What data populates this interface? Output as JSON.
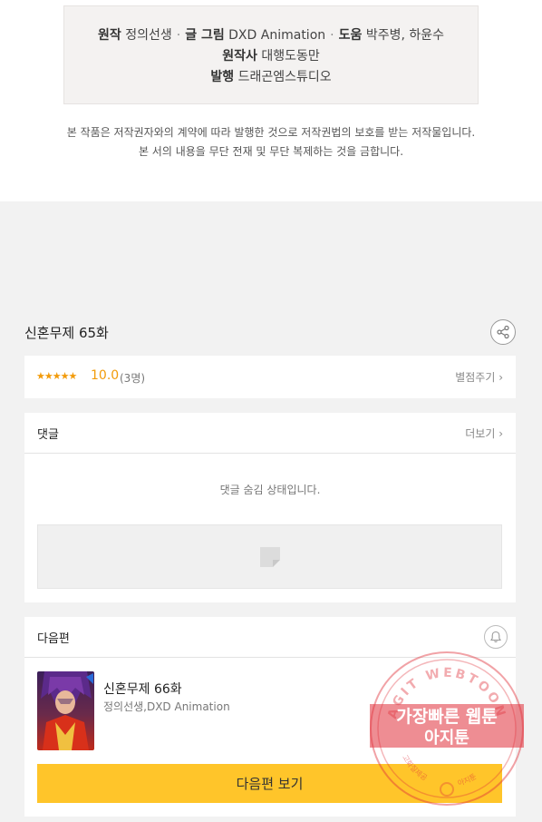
{
  "credits": {
    "line1": [
      {
        "label": "원작",
        "value": "정의선생"
      },
      {
        "label": "글 그림",
        "value": "DXD Animation"
      },
      {
        "label": "도움",
        "value": "박주병, 하윤수"
      }
    ],
    "line2": {
      "label": "원작사",
      "value": "대행도동만"
    },
    "line3": {
      "label": "발행",
      "value": "드래곤엠스튜디오"
    },
    "separator": "·"
  },
  "notice": {
    "line1": "본 작품은 저작권자와의 계약에 따라 발행한 것으로 저작권법의 보호를 받는 저작물입니다.",
    "line2": "본 서의 내용을 무단 전재 및 무단 복제하는 것을 금합니다."
  },
  "episode": {
    "title": "신혼무제 65화",
    "share_icon": "share-icon"
  },
  "rating": {
    "stars": "★★★★★",
    "score": "10.0",
    "count": "(3명)",
    "rate_link": "별점주기 ›"
  },
  "comments": {
    "title": "댓글",
    "more_link": "더보기 ›",
    "hidden_message": "댓글 숨김 상태입니다."
  },
  "next_episode": {
    "section_title": "다음편",
    "bell_icon": "bell-icon",
    "title": "신혼무제 66화",
    "author": "정의선생,DXD Animation",
    "button_label": "다음편 보기"
  },
  "watermark": {
    "top_text": "AGIT WEBTOON",
    "line1": "가장빠른 웹툰",
    "line2": "아지툰",
    "left_text": "고화질제공",
    "right_text": "아지툰"
  },
  "colors": {
    "accent_star": "#f29b0a",
    "button_yellow": "#ffc52a",
    "stamp_red": "#e0303a"
  }
}
